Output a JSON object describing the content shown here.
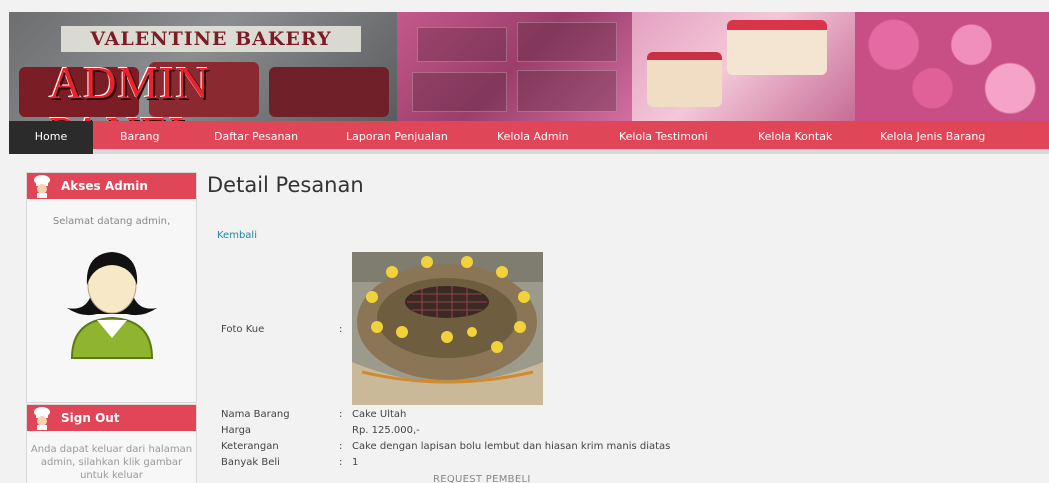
{
  "banner": {
    "subtitle": "VALENTINE BAKERY",
    "title": "ADMIN PANEL"
  },
  "nav": {
    "items": [
      "Home",
      "Barang",
      "Daftar Pesanan",
      "Laporan Penjualan",
      "Kelola Admin",
      "Kelola Testimoni",
      "Kelola Kontak",
      "Kelola Jenis Barang"
    ],
    "active": "Home"
  },
  "sidebar": {
    "admin_title": "Akses Admin",
    "welcome": "Selamat datang admin,",
    "signout_title": "Sign Out",
    "signout_text": "Anda dapat keluar dari halaman admin, silahkan klik gambar untuk keluar"
  },
  "main": {
    "title": "Detail Pesanan",
    "back": "Kembali",
    "photo_label": "Foto Kue",
    "colon": ":",
    "fields": [
      {
        "label": "Nama Barang",
        "colon": ":",
        "value": "Cake Ultah"
      },
      {
        "label": "Harga",
        "colon": "",
        "value": "Rp. 125.000,-"
      },
      {
        "label": "Keterangan",
        "colon": ":",
        "value": "Cake dengan lapisan bolu lembut dan hiasan krim manis diatas"
      },
      {
        "label": "Banyak Beli",
        "colon": ":",
        "value": "1"
      }
    ],
    "request_title": "REQUEST PEMBELI"
  },
  "colors": {
    "accent": "#e14558",
    "nav_active": "#2b2b2b",
    "link": "#2288aa"
  },
  "icons": [
    "chef-icon",
    "avatar-icon"
  ]
}
